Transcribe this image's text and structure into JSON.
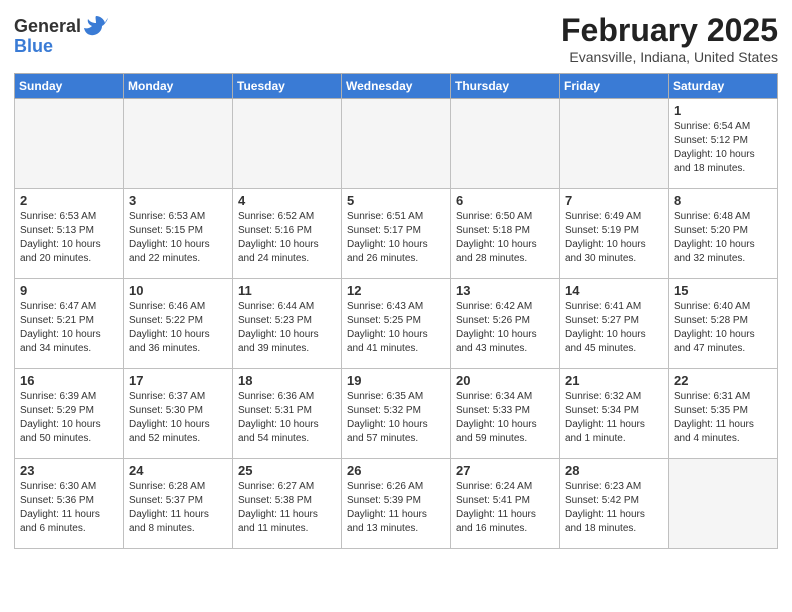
{
  "logo": {
    "general": "General",
    "blue": "Blue",
    "tagline": "🔷"
  },
  "title": "February 2025",
  "subtitle": "Evansville, Indiana, United States",
  "headers": [
    "Sunday",
    "Monday",
    "Tuesday",
    "Wednesday",
    "Thursday",
    "Friday",
    "Saturday"
  ],
  "weeks": [
    [
      {
        "day": "",
        "info": ""
      },
      {
        "day": "",
        "info": ""
      },
      {
        "day": "",
        "info": ""
      },
      {
        "day": "",
        "info": ""
      },
      {
        "day": "",
        "info": ""
      },
      {
        "day": "",
        "info": ""
      },
      {
        "day": "1",
        "info": "Sunrise: 6:54 AM\nSunset: 5:12 PM\nDaylight: 10 hours\nand 18 minutes."
      }
    ],
    [
      {
        "day": "2",
        "info": "Sunrise: 6:53 AM\nSunset: 5:13 PM\nDaylight: 10 hours\nand 20 minutes."
      },
      {
        "day": "3",
        "info": "Sunrise: 6:53 AM\nSunset: 5:15 PM\nDaylight: 10 hours\nand 22 minutes."
      },
      {
        "day": "4",
        "info": "Sunrise: 6:52 AM\nSunset: 5:16 PM\nDaylight: 10 hours\nand 24 minutes."
      },
      {
        "day": "5",
        "info": "Sunrise: 6:51 AM\nSunset: 5:17 PM\nDaylight: 10 hours\nand 26 minutes."
      },
      {
        "day": "6",
        "info": "Sunrise: 6:50 AM\nSunset: 5:18 PM\nDaylight: 10 hours\nand 28 minutes."
      },
      {
        "day": "7",
        "info": "Sunrise: 6:49 AM\nSunset: 5:19 PM\nDaylight: 10 hours\nand 30 minutes."
      },
      {
        "day": "8",
        "info": "Sunrise: 6:48 AM\nSunset: 5:20 PM\nDaylight: 10 hours\nand 32 minutes."
      }
    ],
    [
      {
        "day": "9",
        "info": "Sunrise: 6:47 AM\nSunset: 5:21 PM\nDaylight: 10 hours\nand 34 minutes."
      },
      {
        "day": "10",
        "info": "Sunrise: 6:46 AM\nSunset: 5:22 PM\nDaylight: 10 hours\nand 36 minutes."
      },
      {
        "day": "11",
        "info": "Sunrise: 6:44 AM\nSunset: 5:23 PM\nDaylight: 10 hours\nand 39 minutes."
      },
      {
        "day": "12",
        "info": "Sunrise: 6:43 AM\nSunset: 5:25 PM\nDaylight: 10 hours\nand 41 minutes."
      },
      {
        "day": "13",
        "info": "Sunrise: 6:42 AM\nSunset: 5:26 PM\nDaylight: 10 hours\nand 43 minutes."
      },
      {
        "day": "14",
        "info": "Sunrise: 6:41 AM\nSunset: 5:27 PM\nDaylight: 10 hours\nand 45 minutes."
      },
      {
        "day": "15",
        "info": "Sunrise: 6:40 AM\nSunset: 5:28 PM\nDaylight: 10 hours\nand 47 minutes."
      }
    ],
    [
      {
        "day": "16",
        "info": "Sunrise: 6:39 AM\nSunset: 5:29 PM\nDaylight: 10 hours\nand 50 minutes."
      },
      {
        "day": "17",
        "info": "Sunrise: 6:37 AM\nSunset: 5:30 PM\nDaylight: 10 hours\nand 52 minutes."
      },
      {
        "day": "18",
        "info": "Sunrise: 6:36 AM\nSunset: 5:31 PM\nDaylight: 10 hours\nand 54 minutes."
      },
      {
        "day": "19",
        "info": "Sunrise: 6:35 AM\nSunset: 5:32 PM\nDaylight: 10 hours\nand 57 minutes."
      },
      {
        "day": "20",
        "info": "Sunrise: 6:34 AM\nSunset: 5:33 PM\nDaylight: 10 hours\nand 59 minutes."
      },
      {
        "day": "21",
        "info": "Sunrise: 6:32 AM\nSunset: 5:34 PM\nDaylight: 11 hours\nand 1 minute."
      },
      {
        "day": "22",
        "info": "Sunrise: 6:31 AM\nSunset: 5:35 PM\nDaylight: 11 hours\nand 4 minutes."
      }
    ],
    [
      {
        "day": "23",
        "info": "Sunrise: 6:30 AM\nSunset: 5:36 PM\nDaylight: 11 hours\nand 6 minutes."
      },
      {
        "day": "24",
        "info": "Sunrise: 6:28 AM\nSunset: 5:37 PM\nDaylight: 11 hours\nand 8 minutes."
      },
      {
        "day": "25",
        "info": "Sunrise: 6:27 AM\nSunset: 5:38 PM\nDaylight: 11 hours\nand 11 minutes."
      },
      {
        "day": "26",
        "info": "Sunrise: 6:26 AM\nSunset: 5:39 PM\nDaylight: 11 hours\nand 13 minutes."
      },
      {
        "day": "27",
        "info": "Sunrise: 6:24 AM\nSunset: 5:41 PM\nDaylight: 11 hours\nand 16 minutes."
      },
      {
        "day": "28",
        "info": "Sunrise: 6:23 AM\nSunset: 5:42 PM\nDaylight: 11 hours\nand 18 minutes."
      },
      {
        "day": "",
        "info": ""
      }
    ]
  ]
}
